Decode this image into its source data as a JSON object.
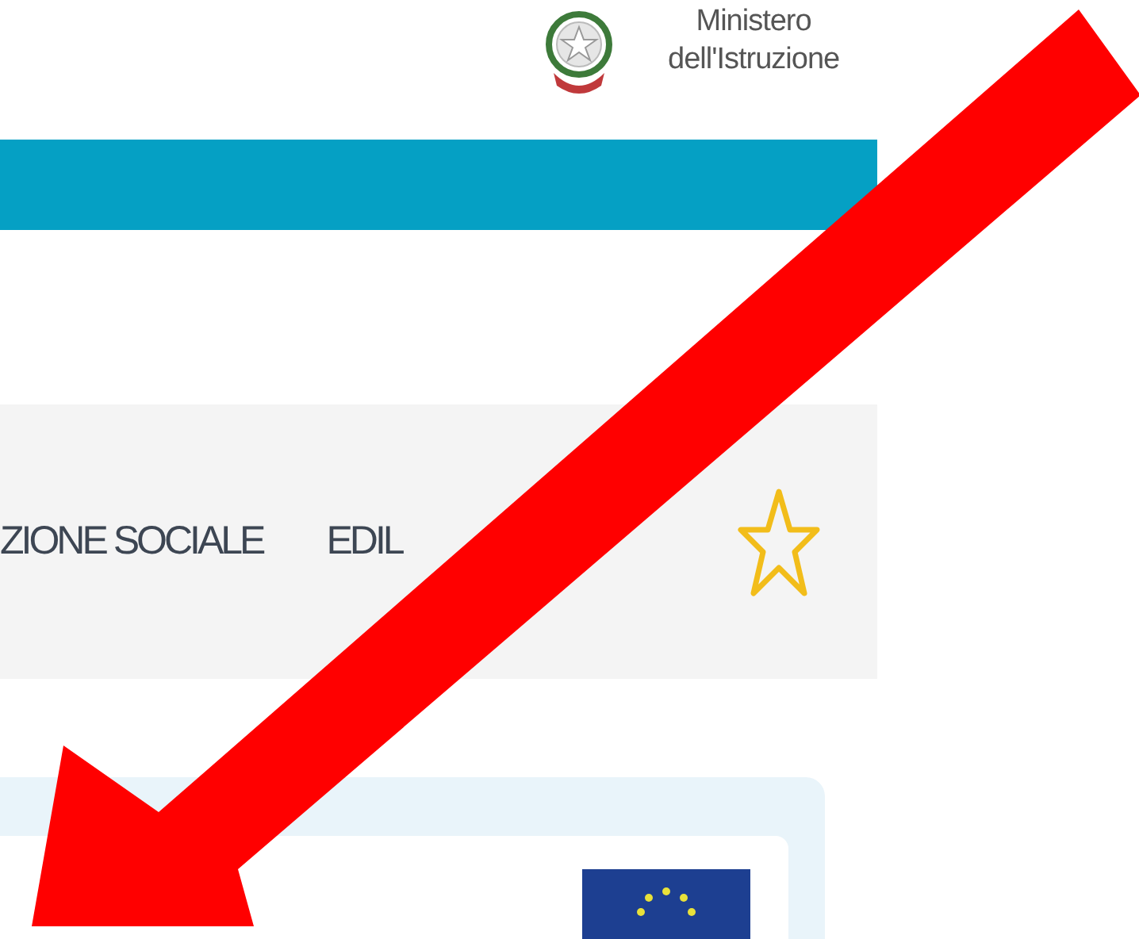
{
  "header": {
    "ministry_name": [
      "Ministero",
      "dell'Istruzione"
    ]
  },
  "nav": {
    "items": [
      "ZIONE SOCIALE",
      "EDIL"
    ]
  }
}
